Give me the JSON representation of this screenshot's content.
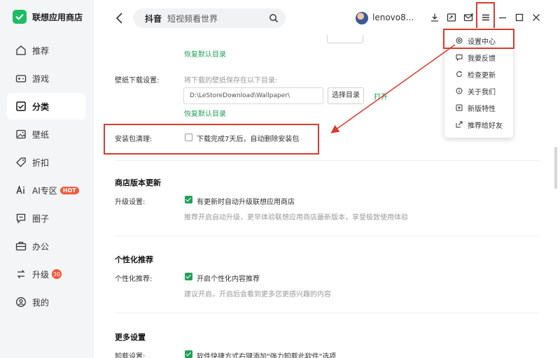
{
  "app": {
    "name": "联想应用商店"
  },
  "sidebar": {
    "items": [
      {
        "label": "推荐",
        "icon": "home-icon"
      },
      {
        "label": "游戏",
        "icon": "gamepad-icon"
      },
      {
        "label": "分类",
        "icon": "category-icon",
        "active": true
      },
      {
        "label": "壁纸",
        "icon": "image-icon"
      },
      {
        "label": "折扣",
        "icon": "tag-icon"
      },
      {
        "label": "AI专区",
        "icon": "ai-icon",
        "badge": "HOT"
      },
      {
        "label": "圈子",
        "icon": "circle-icon"
      },
      {
        "label": "办公",
        "icon": "briefcase-icon"
      },
      {
        "label": "升级",
        "icon": "upgrade-icon",
        "badge": "30"
      },
      {
        "label": "我的",
        "icon": "user-icon"
      }
    ]
  },
  "topbar": {
    "search_keyword": "抖音",
    "search_placeholder": "短视频看世界",
    "username": "lenovo8..."
  },
  "settings": {
    "restore_default_1": "恢复默认目录",
    "wallpaper": {
      "label": "壁纸下载设置:",
      "hint": "将下载的壁纸保存在以下目录:",
      "path": "D:\\LeStoreDownload\\Wallpaper\\",
      "choose_button": "选择目录",
      "open_link": "打开",
      "restore_default": "恢复默认目录"
    },
    "package_cleanup": {
      "label": "安装包清理:",
      "checkbox_label": "下载完成7天后，自动删除安装包",
      "checked": false
    },
    "store_update": {
      "title": "商店版本更新",
      "label": "升级设置:",
      "checkbox_label": "有更新时自动升级联想应用商店",
      "checked": true,
      "hint": "推荐开启自动升级，更早体验联想应用商店最新版本，享受极致使用体验"
    },
    "personalized": {
      "title": "个性化推荐",
      "label": "个性化推荐:",
      "checkbox_label": "开启个性化内容推荐",
      "checked": true,
      "hint": "建议开启，开启后会看到更多您更感兴趣的内容"
    },
    "more": {
      "title": "更多设置",
      "label": "卸载设置:",
      "checkbox_label": "软件快捷方式右键添加\"强力卸载此软件\"选项",
      "checked": true
    }
  },
  "menu": {
    "items": [
      {
        "label": "设置中心",
        "icon": "settings-icon"
      },
      {
        "label": "我要反馈",
        "icon": "feedback-icon"
      },
      {
        "label": "检查更新",
        "icon": "refresh-icon"
      },
      {
        "label": "关于我们",
        "icon": "info-icon"
      },
      {
        "label": "新版特性",
        "icon": "new-features-icon"
      },
      {
        "label": "推荐给好友",
        "icon": "share-icon"
      }
    ]
  },
  "colors": {
    "accent": "#22a05a",
    "highlight": "#d93b30",
    "badge": "#f05a3c"
  }
}
